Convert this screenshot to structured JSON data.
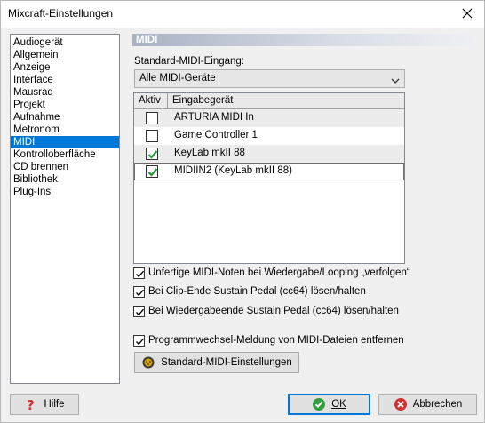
{
  "window": {
    "title": "Mixcraft-Einstellungen"
  },
  "nav": {
    "items": [
      {
        "label": "Audiogerät",
        "selected": false
      },
      {
        "label": "Allgemein",
        "selected": false
      },
      {
        "label": "Anzeige",
        "selected": false
      },
      {
        "label": "Interface",
        "selected": false
      },
      {
        "label": "Mausrad",
        "selected": false
      },
      {
        "label": "Projekt",
        "selected": false
      },
      {
        "label": "Aufnahme",
        "selected": false
      },
      {
        "label": "Metronom",
        "selected": false
      },
      {
        "label": "MIDI",
        "selected": true
      },
      {
        "label": "Kontrolloberfläche",
        "selected": false
      },
      {
        "label": "CD brennen",
        "selected": false
      },
      {
        "label": "Bibliothek",
        "selected": false
      },
      {
        "label": "Plug-Ins",
        "selected": false
      }
    ]
  },
  "midi": {
    "section_title": "MIDI",
    "input_label": "Standard-MIDI-Eingang:",
    "input_value": "Alle MIDI-Geräte",
    "table": {
      "headers": [
        "Aktiv",
        "Eingabegerät"
      ],
      "rows": [
        {
          "device": "ARTURIA MIDI In",
          "active": false
        },
        {
          "device": "Game Controller 1",
          "active": false
        },
        {
          "device": "KeyLab mkII 88",
          "active": true
        },
        {
          "device": "MIDIIN2 (KeyLab mkII 88)",
          "active": true
        }
      ]
    },
    "options": [
      {
        "label": "Unfertige MIDI-Noten bei Wiedergabe/Looping „verfolgen“",
        "checked": true
      },
      {
        "label": "Bei Clip-Ende Sustain Pedal (cc64) lösen/halten",
        "checked": true
      },
      {
        "label": "Bei Wiedergabeende Sustain Pedal (cc64) lösen/halten",
        "checked": true
      },
      {
        "label": "Programmwechsel-Meldung von MIDI-Dateien entfernen",
        "checked": true
      }
    ],
    "defaults_button": "Standard-MIDI-Einstellungen"
  },
  "footer": {
    "help_label": "Hilfe",
    "ok_label": "OK",
    "cancel_label": "Abbrechen"
  },
  "icons": {
    "help": "question-mark-icon",
    "ok": "check-circle-icon",
    "cancel": "cancel-circle-icon",
    "defaults": "midi-plug-icon"
  },
  "colors": {
    "selection": "#0078d7",
    "check_green": "#1e9b3a",
    "cancel_red": "#d32f2f",
    "help_red": "#d32f2f"
  }
}
